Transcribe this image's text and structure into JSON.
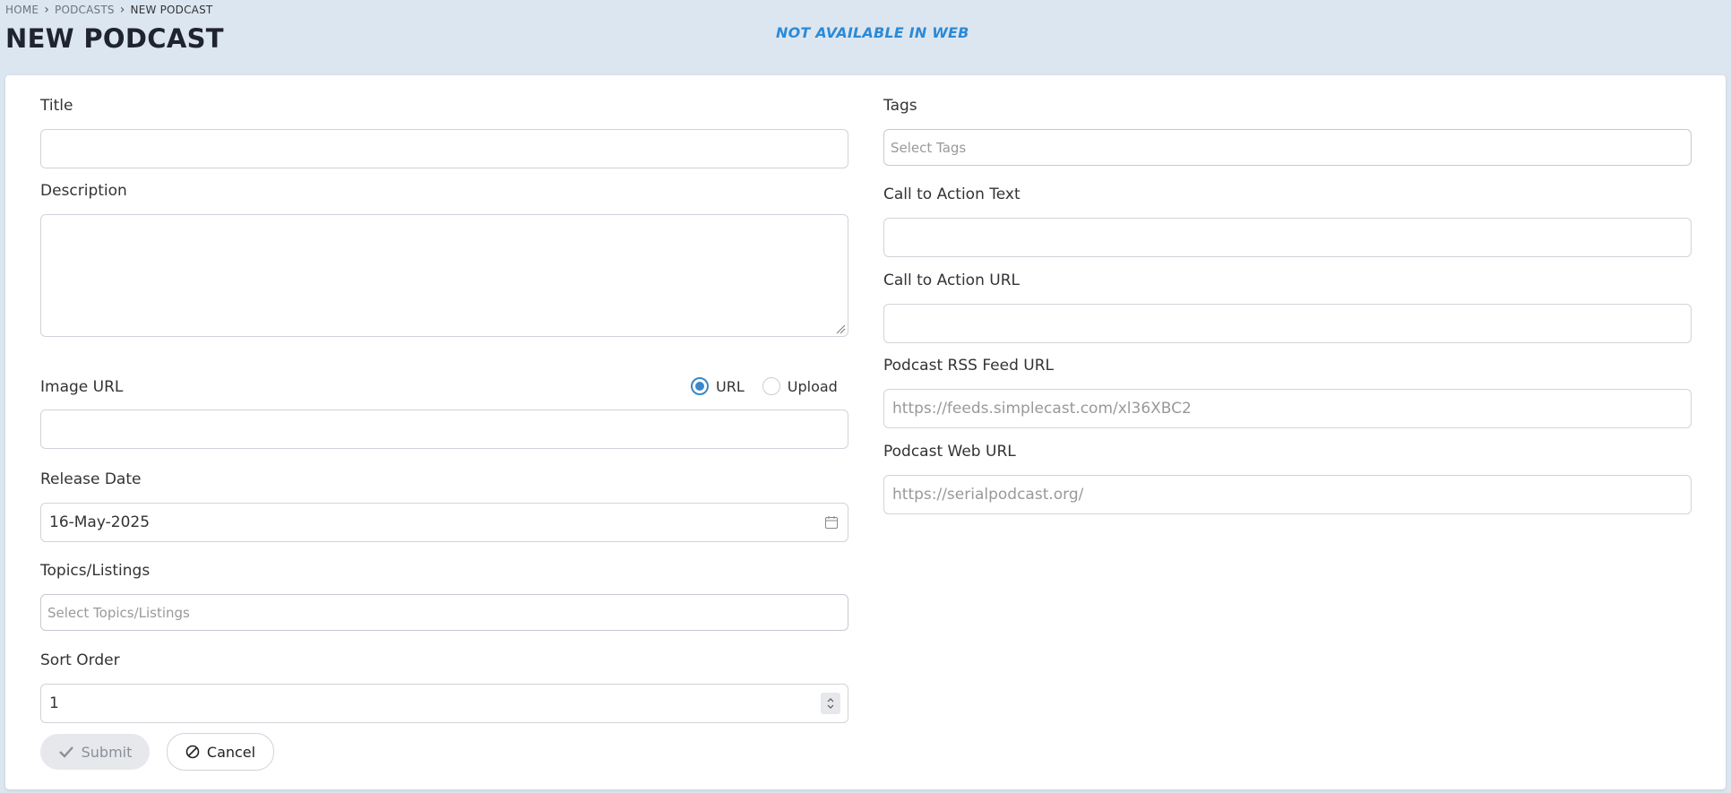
{
  "breadcrumb": {
    "home": "HOME",
    "podcasts": "PODCASTS",
    "current": "NEW PODCAST"
  },
  "page_title": "NEW PODCAST",
  "notice": "NOT AVAILABLE IN WEB",
  "form": {
    "title": {
      "label": "Title",
      "value": ""
    },
    "description": {
      "label": "Description",
      "value": ""
    },
    "image_url": {
      "label": "Image URL",
      "value": "",
      "mode_options": [
        "URL",
        "Upload"
      ],
      "selected_mode": "URL"
    },
    "release_date": {
      "label": "Release Date",
      "value": "16-May-2025",
      "icon": "calendar-icon"
    },
    "topics": {
      "label": "Topics/Listings",
      "placeholder": "Select Topics/Listings"
    },
    "sort_order": {
      "label": "Sort Order",
      "value": "1"
    },
    "tags": {
      "label": "Tags",
      "placeholder": "Select Tags"
    },
    "cta_text": {
      "label": "Call to Action Text",
      "value": ""
    },
    "cta_url": {
      "label": "Call to Action URL",
      "value": ""
    },
    "rss_url": {
      "label": "Podcast RSS Feed URL",
      "placeholder": "https://feeds.simplecast.com/xl36XBC2"
    },
    "web_url": {
      "label": "Podcast Web URL",
      "placeholder": "https://serialpodcast.org/"
    }
  },
  "buttons": {
    "submit": "Submit",
    "cancel": "Cancel"
  },
  "colors": {
    "page_background": "#dce6f1",
    "accent": "#3a87c8",
    "notice": "#2b8ad6"
  }
}
